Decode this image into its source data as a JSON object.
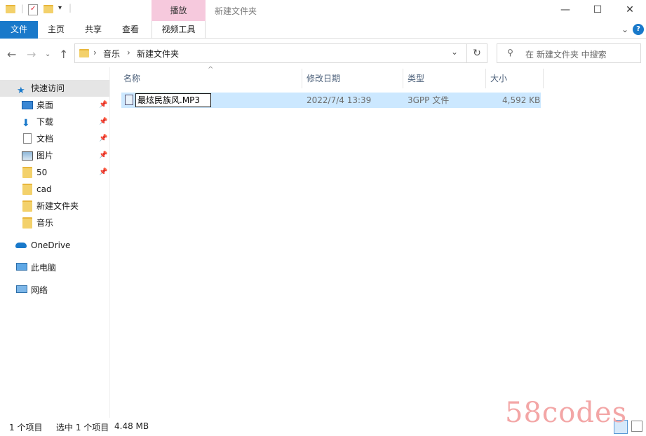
{
  "titlebar": {
    "context_tab": "播放",
    "window_title": "新建文件夹",
    "controls": {
      "minimize": "—",
      "maximize": "☐",
      "close": "✕"
    }
  },
  "ribbon": {
    "tabs": [
      {
        "label": "文件"
      },
      {
        "label": "主页"
      },
      {
        "label": "共享"
      },
      {
        "label": "查看"
      },
      {
        "label": "视频工具"
      }
    ],
    "collapse_glyph": "⌄",
    "help_glyph": "?"
  },
  "address": {
    "breadcrumb": [
      "音乐",
      "新建文件夹"
    ],
    "separator": "›",
    "search_placeholder": "在 新建文件夹 中搜索"
  },
  "nav": {
    "quick_access": "快速访问",
    "items": [
      {
        "label": "桌面",
        "icon": "desktop-icon",
        "pinned": true
      },
      {
        "label": "下载",
        "icon": "download-icon",
        "pinned": true
      },
      {
        "label": "文档",
        "icon": "documents-icon",
        "pinned": true
      },
      {
        "label": "图片",
        "icon": "pictures-icon",
        "pinned": true
      },
      {
        "label": "50",
        "icon": "folder-icon",
        "pinned": true
      },
      {
        "label": "cad",
        "icon": "folder-icon",
        "pinned": false
      },
      {
        "label": "新建文件夹",
        "icon": "folder-icon",
        "pinned": false
      },
      {
        "label": "音乐",
        "icon": "folder-icon",
        "pinned": false
      }
    ],
    "onedrive": "OneDrive",
    "this_pc": "此电脑",
    "network": "网络"
  },
  "columns": {
    "name": "名称",
    "modified": "修改日期",
    "type": "类型",
    "size": "大小"
  },
  "files": [
    {
      "name": "最炫民族风.MP3",
      "modified": "2022/7/4 13:39",
      "type": "3GPP 文件",
      "size": "4,592 KB"
    }
  ],
  "status": {
    "count": "1 个项目",
    "selected": "选中 1 个项目",
    "selected_size": "4.48 MB"
  },
  "watermark": "58codes",
  "colors": {
    "accent": "#1979ca",
    "context_tab": "#f6c9dd",
    "selection": "#cce8ff",
    "folder": "#f3d16b"
  }
}
